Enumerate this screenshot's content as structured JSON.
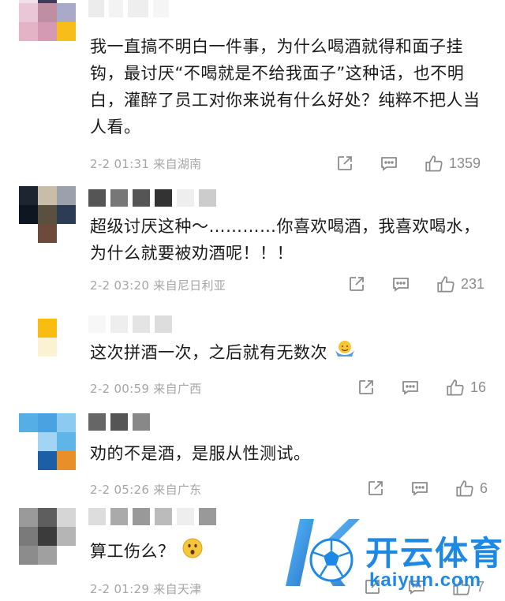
{
  "comments": [
    {
      "text": "我一直搞不明白一件事，为什么喝酒就得和面子挂钩，最讨厌“不喝就是不给我面子”这种话，也不明白，灌醉了员工对你来说有什么好处？纯粹不把人当人看。",
      "meta": "2-2 01:31 来自湖南",
      "likes": "1359"
    },
    {
      "text": "超级讨厌这种～…………你喜欢喝酒，我喜欢喝水，为什么就要被劝酒呢！！！",
      "meta": "2-2 03:20 来自尼日利亚",
      "likes": "231"
    },
    {
      "text": "这次拼酒一次，之后就有无数次",
      "meta": "2-2 00:59 来自广西",
      "likes": "16"
    },
    {
      "text": "劝的不是酒，是服从性测试。",
      "meta": "2-2 05:26 来自广东",
      "likes": "6"
    },
    {
      "text": "算工伤么？",
      "meta": "2-2 01:29 来自天津",
      "likes": "7"
    }
  ],
  "icons": {
    "share": "share-icon",
    "reply": "comment-icon",
    "like": "thumbs-up-icon"
  },
  "watermark": {
    "brand_cn": "开云体育",
    "brand_en": "kaiyun.com"
  },
  "colors": {
    "meta_gray": "#a6a6a6",
    "brand_blue": "#1e88e5"
  }
}
